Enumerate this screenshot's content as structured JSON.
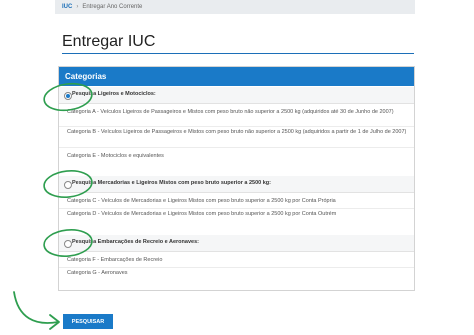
{
  "breadcrumb": {
    "root": "IUC",
    "separator": "›",
    "current": "Entregar Ano Corrente"
  },
  "page": {
    "title": "Entregar IUC"
  },
  "panel": {
    "header": "Categorias"
  },
  "groups": [
    {
      "label": "Pesquisa Ligeiros e Motociclos:",
      "selected": true,
      "items": [
        "Categoria A - Veículos Ligeiros de Passageiros e Mistos com peso bruto não superior a 2500 kg (adquiridos até 30 de Junho de 2007)",
        "Categoria B - Veículos Ligeiros de Passageiros e Mistos com peso bruto não superior a 2500 kg (adquiridos a partir de 1 de Julho de 2007)",
        "Categoria E - Motociclos e equivalentes"
      ]
    },
    {
      "label": "Pesquisa Mercadorias e Ligeiros Mistos com peso bruto superior a 2500 kg:",
      "selected": false,
      "items": [
        "Categoria C - Veículos de Mercadorias e Ligeiros Mistos com peso bruto superior a 2500 kg por Conta Própria",
        "Categoria D - Veículos de Mercadorias e Ligeiros Mistos com peso bruto superior a 2500 kg por Conta Outrém"
      ]
    },
    {
      "label": "Pesquisa Embarcações de Recreio e Aeronaves:",
      "selected": false,
      "items": [
        "Categoria F - Embarcações de Recreio",
        "Categoria G - Aeronaves"
      ]
    }
  ],
  "actions": {
    "search_label": "PESQUISAR"
  },
  "colors": {
    "primary": "#1a7ac8",
    "annotation": "#2e9e4f"
  }
}
